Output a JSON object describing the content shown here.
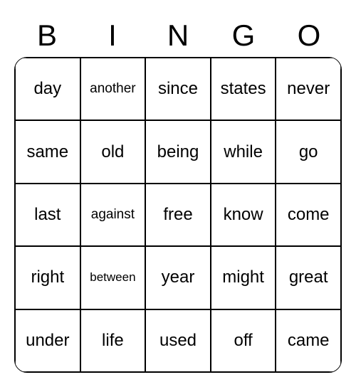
{
  "header": [
    "B",
    "I",
    "N",
    "G",
    "O"
  ],
  "cells": [
    {
      "text": "day",
      "size": "normal"
    },
    {
      "text": "another",
      "size": "small"
    },
    {
      "text": "since",
      "size": "normal"
    },
    {
      "text": "states",
      "size": "normal"
    },
    {
      "text": "never",
      "size": "normal"
    },
    {
      "text": "same",
      "size": "normal"
    },
    {
      "text": "old",
      "size": "normal"
    },
    {
      "text": "being",
      "size": "normal"
    },
    {
      "text": "while",
      "size": "normal"
    },
    {
      "text": "go",
      "size": "normal"
    },
    {
      "text": "last",
      "size": "normal"
    },
    {
      "text": "against",
      "size": "small"
    },
    {
      "text": "free",
      "size": "normal"
    },
    {
      "text": "know",
      "size": "normal"
    },
    {
      "text": "come",
      "size": "normal"
    },
    {
      "text": "right",
      "size": "normal"
    },
    {
      "text": "between",
      "size": "xsmall"
    },
    {
      "text": "year",
      "size": "normal"
    },
    {
      "text": "might",
      "size": "normal"
    },
    {
      "text": "great",
      "size": "normal"
    },
    {
      "text": "under",
      "size": "normal"
    },
    {
      "text": "life",
      "size": "normal"
    },
    {
      "text": "used",
      "size": "normal"
    },
    {
      "text": "off",
      "size": "normal"
    },
    {
      "text": "came",
      "size": "normal"
    }
  ]
}
